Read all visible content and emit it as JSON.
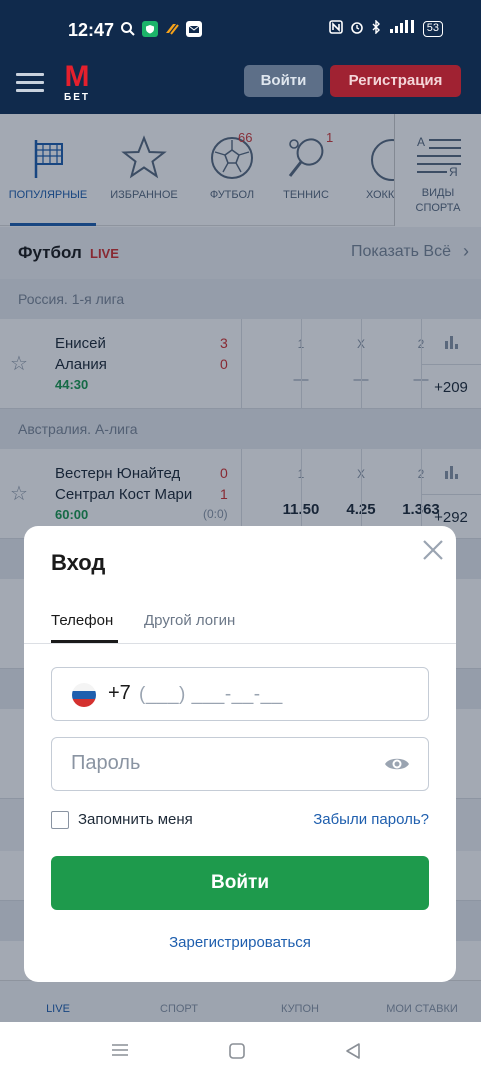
{
  "status_bar": {
    "time": "12:47",
    "battery": "53"
  },
  "header": {
    "logo_letter": "М",
    "logo_sub": "БЕТ",
    "login_label": "Войти",
    "register_label": "Регистрация"
  },
  "categories": [
    {
      "label": "ПОПУЛЯРНЫЕ",
      "icon": "flag-icon",
      "count": ""
    },
    {
      "label": "ИЗБРАННОЕ",
      "icon": "star-icon",
      "count": ""
    },
    {
      "label": "ФУТБОЛ",
      "icon": "soccer-ball-icon",
      "count": "66"
    },
    {
      "label": "ТЕННИС",
      "icon": "tennis-racket-icon",
      "count": "1"
    },
    {
      "label": "ХОККЕЙ",
      "icon": "hockey-icon",
      "count": ""
    }
  ],
  "all_sports": {
    "line1": "ВИДЫ",
    "line2": "СПОРТА"
  },
  "football": {
    "title": "Футбол",
    "live": "LIVE",
    "show_all": "Показать Всё"
  },
  "leagues": [
    "Россия. 1-я лига",
    "Австралия. А-лига"
  ],
  "matches": [
    {
      "team1": "Енисей",
      "team2": "Алания",
      "score1": "3",
      "score2": "0",
      "time": "44:30",
      "sub": "",
      "odds": [
        {
          "h": "1",
          "v": "—"
        },
        {
          "h": "X",
          "v": "—"
        },
        {
          "h": "2",
          "v": "—"
        }
      ],
      "more": "+209"
    },
    {
      "team1": "Вестерн Юнайтед",
      "team2": "Сентрал Кост Мари",
      "score1": "0",
      "score2": "1",
      "time": "60:00",
      "sub": "(0:0)",
      "odds": [
        {
          "h": "1",
          "v": "11.50"
        },
        {
          "h": "X",
          "v": "4.25"
        },
        {
          "h": "2",
          "v": "1.363"
        }
      ],
      "more": "+292"
    }
  ],
  "bottom_nav": [
    "LIVE",
    "СПОРТ",
    "КУПОН",
    "МОИ СТАВКИ"
  ],
  "modal": {
    "title": "Вход",
    "tab_phone": "Телефон",
    "tab_other": "Другой логин",
    "phone_code": "+7",
    "phone_mask": "(___) ___-__-__",
    "password_placeholder": "Пароль",
    "remember": "Запомнить меня",
    "forgot": "Забыли пароль?",
    "submit": "Войти",
    "register": "Зарегистрироваться"
  },
  "colors": {
    "navy": "#102a4c",
    "accent_blue": "#1f5fae",
    "green": "#1e9a4c",
    "red": "#d4312f"
  }
}
